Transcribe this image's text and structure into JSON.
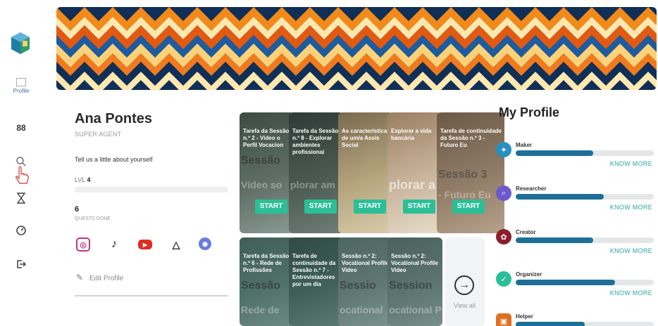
{
  "sidebar": {
    "profile_label": "Profile",
    "items": [
      {
        "icon": "grid-icon",
        "glyph": "88"
      },
      {
        "icon": "search-icon",
        "glyph": "⌕"
      },
      {
        "icon": "hourglass-icon",
        "glyph": "⌛"
      },
      {
        "icon": "clock-icon",
        "glyph": "◷"
      },
      {
        "icon": "logout-icon",
        "glyph": "⇥"
      }
    ]
  },
  "profile": {
    "name": "Ana Pontes",
    "role": "SUPER AGENT",
    "about": "Tell us a little about yourself",
    "level_label": "LVL",
    "level_value": "4",
    "quests_done": "6",
    "quests_label": "QUESTS DONE",
    "edit_label": "Edit Profile",
    "socials": [
      {
        "icon": "instagram-icon",
        "color": "#c13584"
      },
      {
        "icon": "tiktok-icon",
        "color": "#222222"
      },
      {
        "icon": "youtube-icon",
        "color": "#e02b20"
      },
      {
        "icon": "google-drive-icon",
        "color": "#333333"
      },
      {
        "icon": "discord-icon",
        "color": "#6b7bd9"
      }
    ]
  },
  "cards_row1": [
    {
      "text": "Tarefa da Sessão n.º 2 - Vídeo o Perfil Vocacion",
      "big": "Sessão",
      "faint": "Vídeo so",
      "start": "START"
    },
    {
      "text": "Tarefa da Sessão n.º 8 - Explorar ambientes profissionai",
      "big": "",
      "faint": "plorar am",
      "start": "START"
    },
    {
      "text": "As características de um/a Assis Social",
      "big": "",
      "faint": "",
      "start": "START"
    },
    {
      "text": "Explorar a vida bancária",
      "big": "",
      "faint": "plorar a",
      "start": "START"
    },
    {
      "text": "Tarefa de continuidade da Sessão n.º 3 - Futuro Eu",
      "big": "Sessão 3",
      "faint": "- Futuro Eu",
      "start": "START"
    }
  ],
  "cards_row2": [
    {
      "text": "Tarefa da Sessão n.º 6 - Rede de Profissões",
      "big": "Sessão",
      "faint": "Rede de"
    },
    {
      "text": "Tarefa de continuidade da Sessão n.º 7 - Entrevistadores por um dia",
      "big": "",
      "faint": ""
    },
    {
      "text": "Sessão n.º 2: Vocational Profile Video",
      "big": "Sessio",
      "faint": "ocational"
    },
    {
      "text": "Sessão n.º 2: Vocational Profile Video",
      "big": "Session",
      "faint": "ocational Pr"
    }
  ],
  "view_all": "View all",
  "my_profile": {
    "title": "My Profile",
    "know_more": "KNOW MORE",
    "traits": [
      {
        "name": "Maker",
        "level": 0.56,
        "color": "#2a8fc0",
        "icon": "compass-icon"
      },
      {
        "name": "Researcher",
        "level": 0.64,
        "color": "#6a5acd",
        "icon": "magnifier-icon"
      },
      {
        "name": "Creator",
        "level": 0.56,
        "color": "#8b1e2a",
        "icon": "palette-icon"
      },
      {
        "name": "Organizer",
        "level": 0.72,
        "color": "#2bbf97",
        "icon": "checklist-icon"
      },
      {
        "name": "Helper",
        "level": 0.5,
        "color": "#e07020",
        "icon": "hands-icon"
      }
    ]
  }
}
